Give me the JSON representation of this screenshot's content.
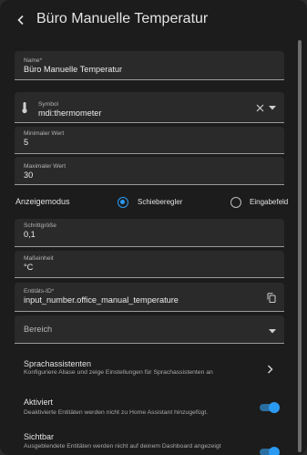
{
  "header": {
    "title": "Büro Manuelle Temperatur"
  },
  "fields": {
    "name": {
      "label": "Name*",
      "value": "Büro Manuelle Temperatur"
    },
    "symbol": {
      "label": "Symbol",
      "value": "mdi:thermometer"
    },
    "min": {
      "label": "Minimaler Wert",
      "value": "5"
    },
    "max": {
      "label": "Maximaler Wert",
      "value": "30"
    },
    "step": {
      "label": "Schrittgröße",
      "value": "0,1"
    },
    "unit": {
      "label": "Maßeinheit",
      "value": "°C"
    },
    "entity_id": {
      "label": "Entitäts-ID*",
      "value": "input_number.office_manual_temperature"
    },
    "area": {
      "placeholder": "Bereich"
    }
  },
  "display_mode": {
    "label": "Anzeigemodus",
    "options": [
      {
        "label": "Schieberegler",
        "selected": true
      },
      {
        "label": "Eingabefeld",
        "selected": false
      }
    ]
  },
  "voice": {
    "title": "Sprachassistenten",
    "subtitle": "Konfiguriere Aliase und zeige Einstellungen für Sprachassistenten an"
  },
  "enabled": {
    "title": "Aktiviert",
    "subtitle": "Deaktivierte Entitäten werden nicht zu Home Assistant hinzugefügt.",
    "on": true
  },
  "visible": {
    "title": "Sichtbar",
    "subtitle": "Ausgeblendete Entitäten werden nicht auf deinem Dashboard angezeigt",
    "on": true
  },
  "colors": {
    "accent": "#2b9af3",
    "surface": "#1c1c1c",
    "field": "#2a2a2a"
  }
}
